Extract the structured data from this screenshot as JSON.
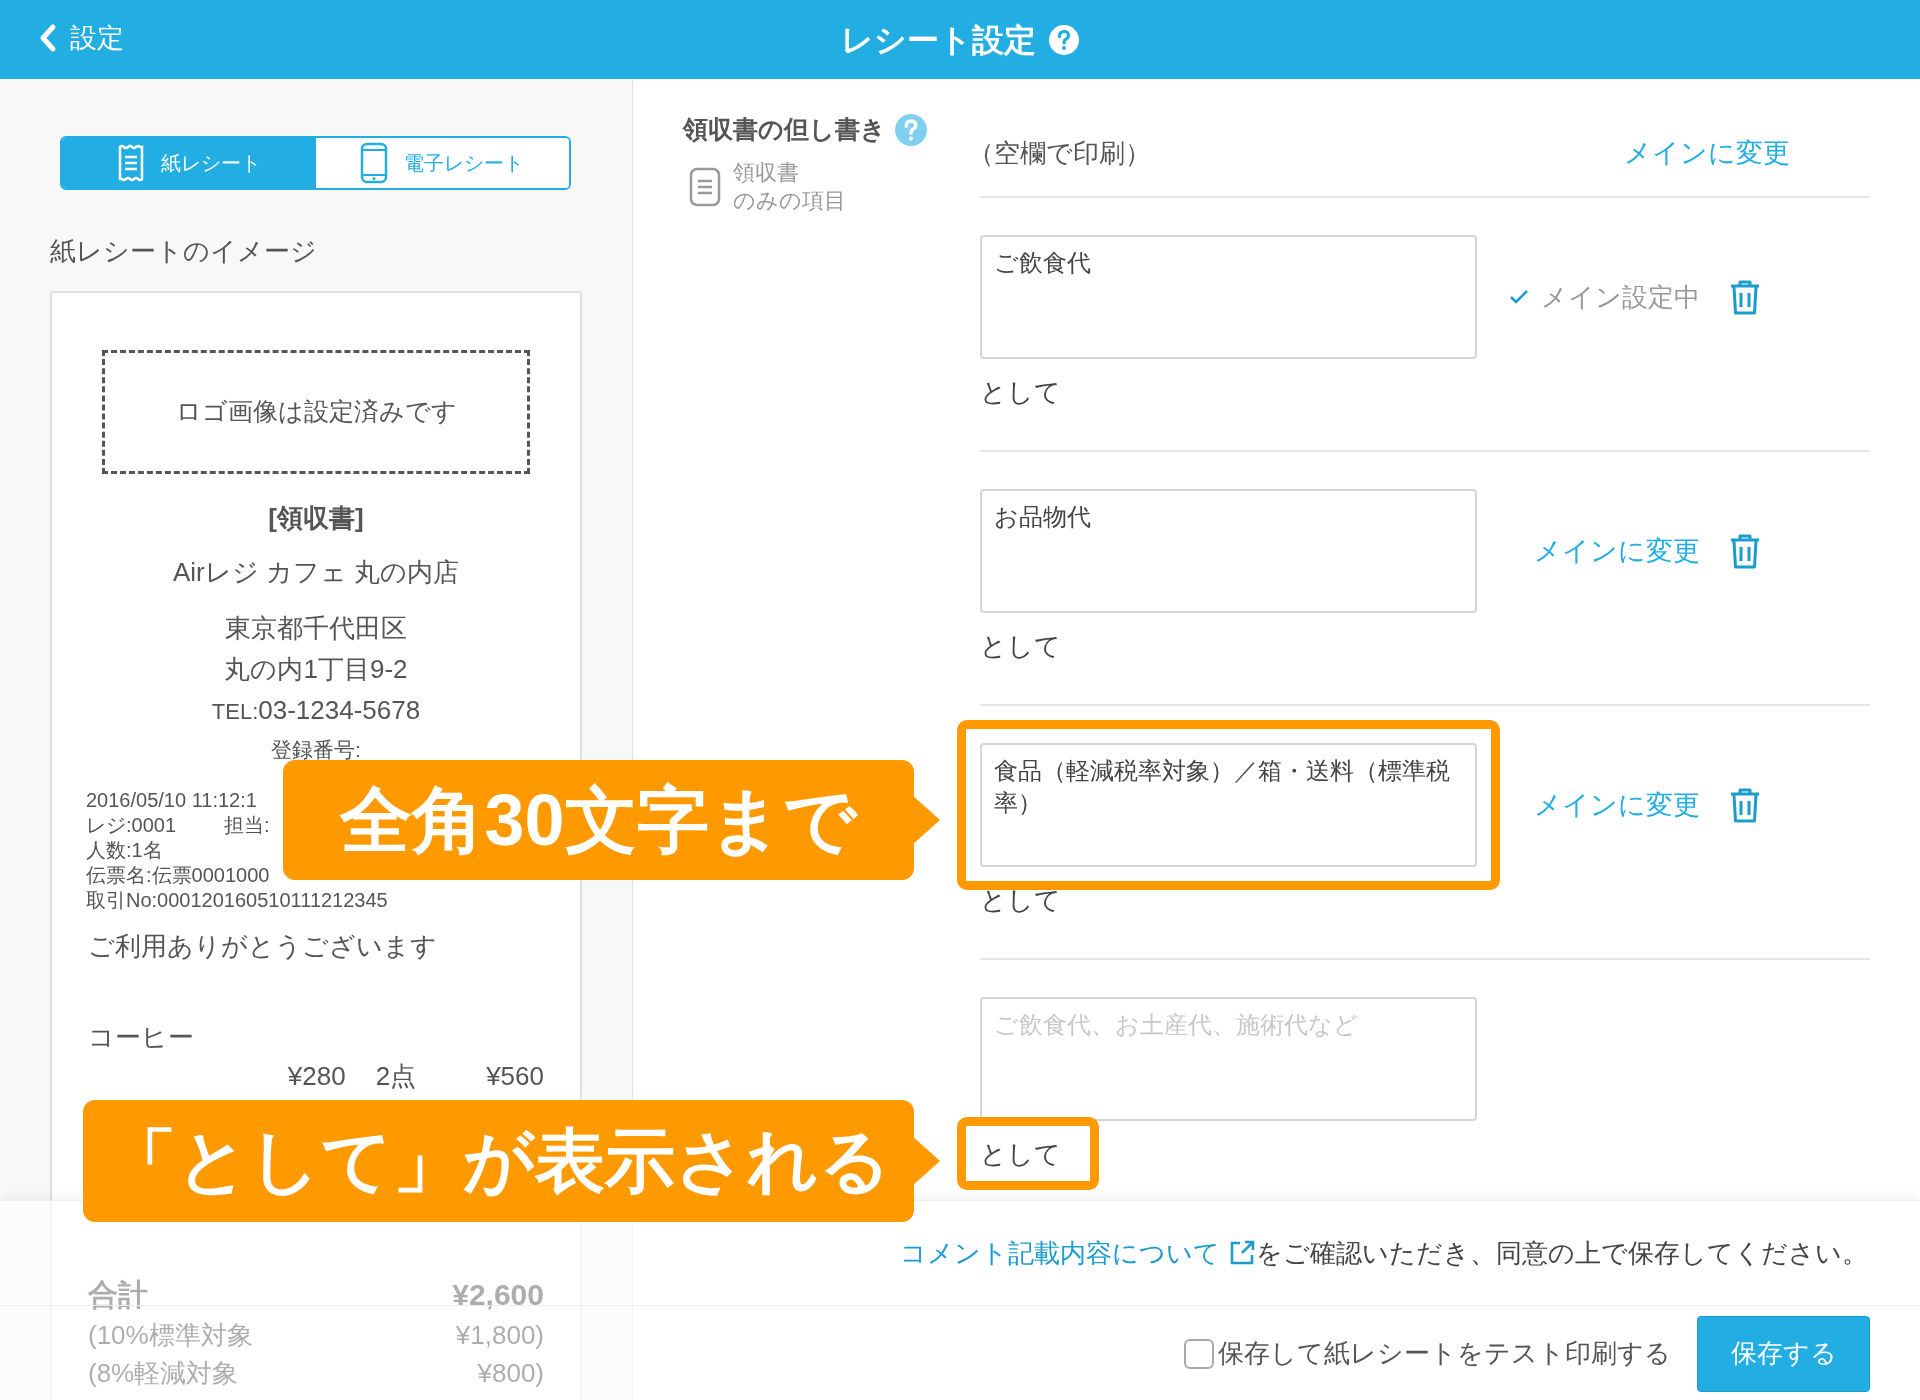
{
  "header": {
    "back_label": "設定",
    "title": "レシート設定"
  },
  "receipt_tabs": [
    {
      "label": "紙レシート",
      "kind": "paper",
      "selected": true
    },
    {
      "label": "電子レシート",
      "kind": "phone",
      "selected": false
    }
  ],
  "preview": {
    "title": "紙レシートのイメージ",
    "logo_placeholder": "ロゴ画像は設定済みです",
    "heading": "[領収書]",
    "store": "Airレジ カフェ 丸の内店",
    "address": [
      "東京都千代田区",
      "丸の内1丁目9-2"
    ],
    "tel_label": "TEL:",
    "tel": "03-1234-5678",
    "registration": "登録番号:",
    "details": [
      [
        "2016/05/10 11:12:1"
      ],
      [
        "レジ:0001",
        "担当:"
      ],
      [
        "人数:1名"
      ],
      [
        "伝票名:伝票0001000"
      ],
      [
        "取引No:000120160510111212345"
      ]
    ],
    "thanks": "ご利用ありがとうございます",
    "items": [
      {
        "name": "コーヒー",
        "unit_price": "¥280",
        "quantity": "2点",
        "amount": "¥560"
      }
    ],
    "totals": [
      {
        "label": "合計",
        "amount": "¥2,600",
        "kind": "total"
      },
      {
        "label": "(10%標準対象",
        "amount": "¥1,800)",
        "kind": "sub"
      },
      {
        "label": "(8%軽減対象",
        "amount": "¥800)",
        "kind": "sub"
      }
    ]
  },
  "proviso": {
    "title": "領収書の但し書き",
    "note_lines": [
      "領収書",
      "のみの項目"
    ],
    "blank_option": {
      "label": "（空欄で印刷）",
      "action": "メインに変更"
    },
    "entries": [
      {
        "kind": "saved",
        "value": "ご飲食代",
        "suffix": "として",
        "main": true,
        "status": "メイン設定中",
        "highlighted": false,
        "suffix_highlighted": false
      },
      {
        "kind": "saved",
        "value": "お品物代",
        "suffix": "として",
        "main": false,
        "action": "メインに変更",
        "highlighted": false,
        "suffix_highlighted": false
      },
      {
        "kind": "saved",
        "value": "食品（軽減税率対象）／箱・送料（標準税率）",
        "suffix": "として",
        "main": false,
        "action": "メインに変更",
        "highlighted": true,
        "suffix_highlighted": false
      },
      {
        "kind": "new",
        "placeholder": "ご飲食代、お土産代、施術代など",
        "suffix": "として",
        "highlighted": false,
        "suffix_highlighted": true
      }
    ]
  },
  "callouts": [
    {
      "text": "全角30文字まで"
    },
    {
      "text": "「として」が表示される"
    }
  ],
  "footer": {
    "notice_link": "コメント記載内容について",
    "notice_text": "をご確認いただき、同意の上で保存してください。",
    "test_print": {
      "label": "保存して紙レシートをテスト印刷する",
      "checked": false
    },
    "save": "保存する"
  }
}
